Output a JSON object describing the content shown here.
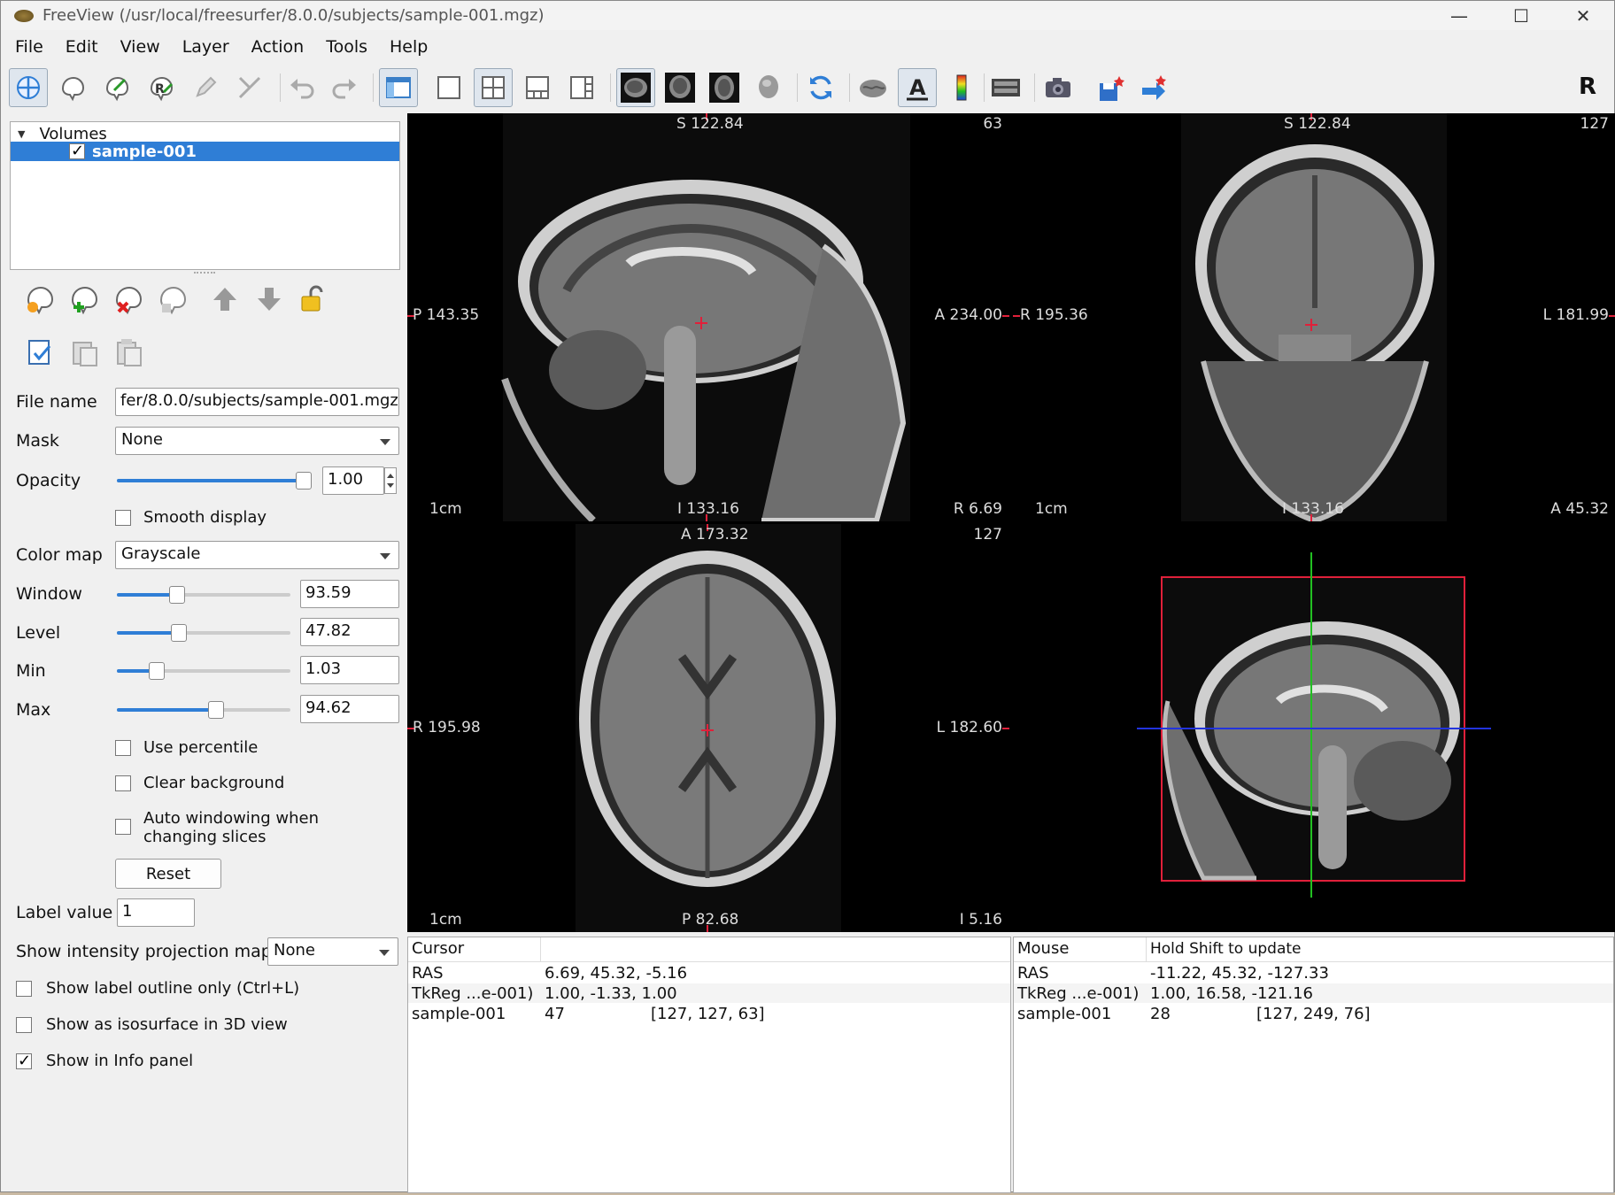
{
  "window": {
    "title": "FreeView (/usr/local/freesurfer/8.0.0/subjects/sample-001.mgz)",
    "minimize": "—",
    "maximize": "☐",
    "close": "✕"
  },
  "menu": [
    "File",
    "Edit",
    "View",
    "Layer",
    "Action",
    "Tools",
    "Help"
  ],
  "toolbar": {
    "right_glyph": "R",
    "icons": [
      "navigate-icon",
      "roi-edit-icon",
      "voxel-edit-icon",
      "recon-edit-icon",
      "pencil-icon",
      "measure-icon",
      "undo-icon",
      "redo-icon",
      "toggle-panel-icon",
      "layout-1x1-icon",
      "layout-2x2-icon",
      "layout-1-3-icon",
      "layout-1-3h-icon",
      "view-sagittal-icon",
      "view-coronal-icon",
      "view-axial-icon",
      "view-3d-icon",
      "reset-view-icon",
      "surface-icon",
      "text-annotation-icon",
      "colorbar-icon",
      "coordinate-icon",
      "screenshot-icon",
      "save-point-icon",
      "goto-point-icon"
    ]
  },
  "layers": {
    "group": "Volumes",
    "item": "sample-001",
    "item_checked": true
  },
  "props": {
    "file_name_label": "File name",
    "file_name": "fer/8.0.0/subjects/sample-001.mgz",
    "mask_label": "Mask",
    "mask": "None",
    "opacity_label": "Opacity",
    "opacity": "1.00",
    "opacity_frac": 1.0,
    "smooth_display": "Smooth display",
    "color_map_label": "Color map",
    "color_map": "Grayscale",
    "window_label": "Window",
    "window": "93.59",
    "window_frac": 0.33,
    "level_label": "Level",
    "level": "47.82",
    "level_frac": 0.34,
    "min_label": "Min",
    "min": "1.03",
    "min_frac": 0.2,
    "max_label": "Max",
    "max": "94.62",
    "max_frac": 0.58,
    "use_percentile": "Use percentile",
    "clear_background": "Clear background",
    "auto_windowing_1": "Auto windowing when",
    "auto_windowing_2": "changing slices",
    "reset": "Reset",
    "label_value_label": "Label value",
    "label_value": "1",
    "projection_label": "Show intensity projection map",
    "projection": "None",
    "label_outline": "Show label outline only (Ctrl+L)",
    "isosurface": "Show as isosurface in 3D view",
    "show_info": "Show in Info panel"
  },
  "views": {
    "sagittal": {
      "top": "S 122.84",
      "slice": "63",
      "left": "P 143.35",
      "right": "A 234.00",
      "bottom": "I 133.16",
      "corner": "R 6.69",
      "scale": "1cm"
    },
    "coronal": {
      "top": "S 122.84",
      "slice": "127",
      "left": "R 195.36",
      "right": "L 181.99",
      "bottom": "I 133.16",
      "corner": "A 45.32",
      "scale": "1cm"
    },
    "axial": {
      "top": "A 173.32",
      "slice": "127",
      "left": "R 195.98",
      "right": "L 182.60",
      "bottom": "P 82.68",
      "corner": "I 5.16",
      "scale": "1cm"
    }
  },
  "info_cursor": {
    "header": "Cursor",
    "rows": [
      {
        "name": "RAS",
        "value": "6.69, 45.32, -5.16",
        "extra": ""
      },
      {
        "name": "TkReg ...e-001)",
        "value": "1.00, -1.33, 1.00",
        "extra": ""
      },
      {
        "name": "sample-001",
        "value": "47",
        "extra": "[127, 127, 63]"
      }
    ]
  },
  "info_mouse": {
    "header": "Mouse",
    "header2": "Hold Shift to update",
    "rows": [
      {
        "name": "RAS",
        "value": "-11.22, 45.32, -127.33",
        "extra": ""
      },
      {
        "name": "TkReg ...e-001)",
        "value": "1.00, 16.58, -121.16",
        "extra": ""
      },
      {
        "name": "sample-001",
        "value": "28",
        "extra": "[127, 249, 76]"
      }
    ]
  },
  "colors": {
    "accent": "#2f7ed6",
    "cursor": "#e0203a",
    "bbox": "#e0203a",
    "axis_green": "#22c022",
    "axis_blue": "#2233dd"
  }
}
